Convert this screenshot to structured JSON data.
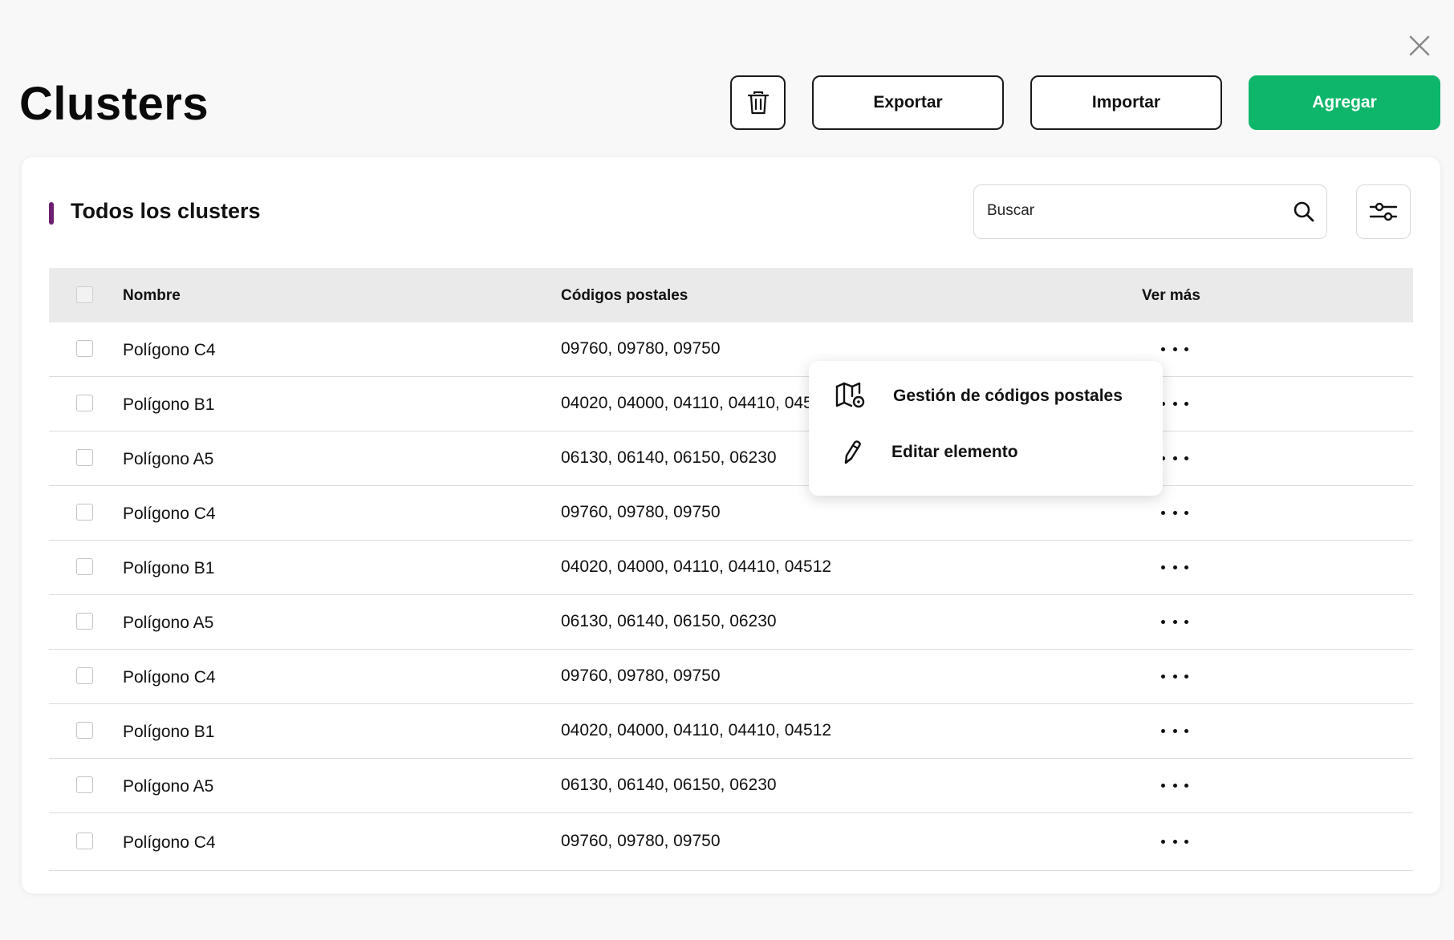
{
  "page": {
    "title": "Clusters"
  },
  "toolbar": {
    "export_label": "Exportar",
    "import_label": "Importar",
    "add_label": "Agregar"
  },
  "card": {
    "title": "Todos los clusters",
    "search_placeholder": "Buscar"
  },
  "table": {
    "headers": {
      "name": "Nombre",
      "codes": "Códigos postales",
      "more": "Ver más"
    },
    "rows": [
      {
        "name": "Polígono C4",
        "codes": "09760, 09780, 09750"
      },
      {
        "name": "Polígono B1",
        "codes": "04020, 04000, 04110, 04410, 04512"
      },
      {
        "name": "Polígono A5",
        "codes": "06130, 06140, 06150, 06230"
      },
      {
        "name": "Polígono C4",
        "codes": "09760, 09780, 09750"
      },
      {
        "name": "Polígono B1",
        "codes": "04020, 04000, 04110, 04410, 04512"
      },
      {
        "name": "Polígono A5",
        "codes": "06130, 06140, 06150, 06230"
      },
      {
        "name": "Polígono C4",
        "codes": "09760, 09780, 09750"
      },
      {
        "name": "Polígono B1",
        "codes": "04020, 04000, 04110, 04410, 04512"
      },
      {
        "name": "Polígono A5",
        "codes": "06130, 06140, 06150, 06230"
      },
      {
        "name": "Polígono C4",
        "codes": "09760, 09780, 09750"
      }
    ]
  },
  "dropdown": {
    "items": [
      {
        "label": "Gestión de códigos postales",
        "icon": "map-pin-icon"
      },
      {
        "label": "Editar elemento",
        "icon": "pencil-icon"
      }
    ]
  },
  "colors": {
    "accent_green": "#0db66a",
    "accent_purple": "#6b1f6e",
    "background": "#f8f8f8"
  }
}
